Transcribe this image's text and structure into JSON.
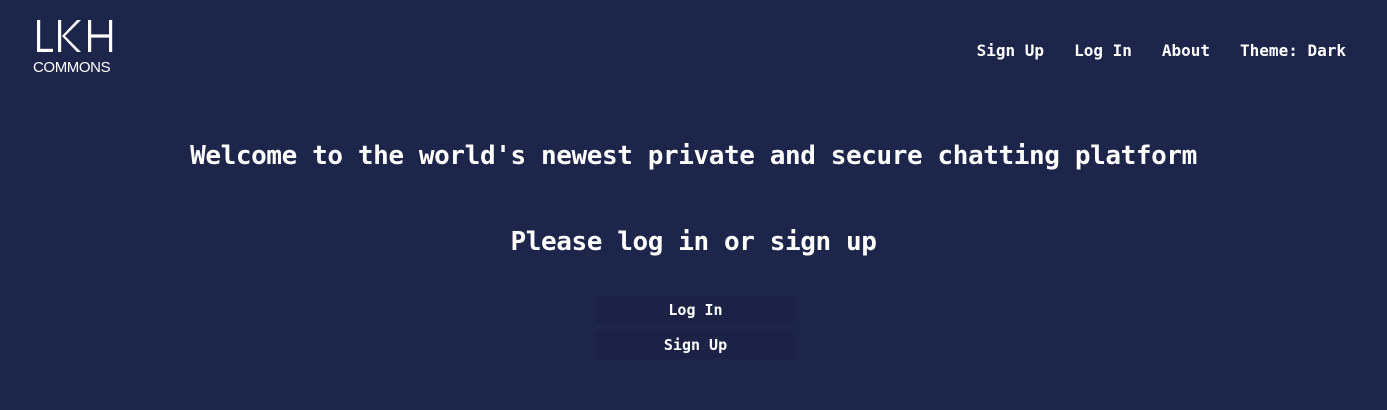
{
  "logo": {
    "mark": "LKH",
    "subtitle": "COMMONS"
  },
  "nav": {
    "items": [
      {
        "label": "Sign Up"
      },
      {
        "label": "Log In"
      },
      {
        "label": "About"
      },
      {
        "label": "Theme: Dark"
      }
    ]
  },
  "main": {
    "welcome": "Welcome to the world's newest private and secure chatting platform",
    "prompt": "Please log in or sign up",
    "login_button": "Log In",
    "signup_button": "Sign Up"
  },
  "colors": {
    "background": "#1e254a",
    "button_background": "#1b2245",
    "text": "#ffffff"
  }
}
